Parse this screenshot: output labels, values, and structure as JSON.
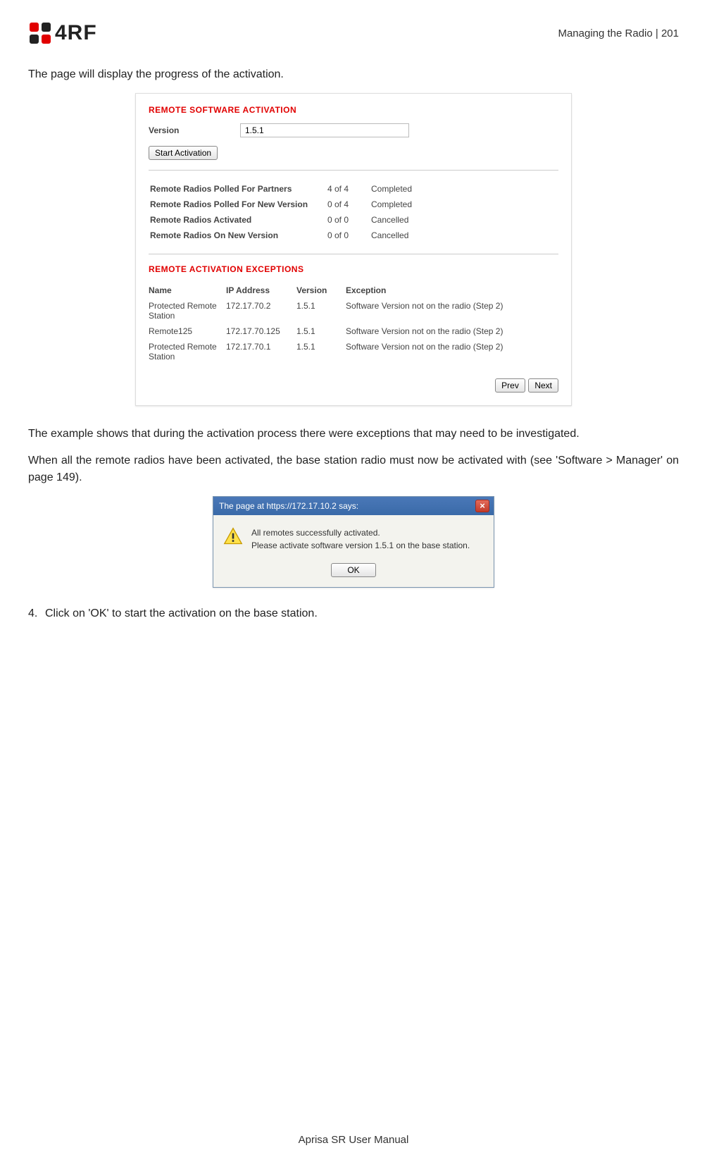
{
  "header": {
    "brand": "4RF",
    "page_ref": "Managing the Radio  |  201"
  },
  "intro": "The page will display the progress of the activation.",
  "fig1": {
    "section1_title": "REMOTE SOFTWARE ACTIVATION",
    "version_label": "Version",
    "version_value": "1.5.1",
    "start_btn": "Start Activation",
    "progress": [
      {
        "label": "Remote Radios Polled For Partners",
        "count": "4 of 4",
        "status": "Completed"
      },
      {
        "label": "Remote Radios Polled For New Version",
        "count": "0 of 4",
        "status": "Completed"
      },
      {
        "label": "Remote Radios Activated",
        "count": "0 of 0",
        "status": "Cancelled"
      },
      {
        "label": "Remote Radios On New Version",
        "count": "0 of 0",
        "status": "Cancelled"
      }
    ],
    "section2_title": "REMOTE ACTIVATION EXCEPTIONS",
    "exc_headers": {
      "name": "Name",
      "ip": "IP Address",
      "version": "Version",
      "exception": "Exception"
    },
    "exceptions": [
      {
        "name": "Protected Remote Station",
        "ip": "172.17.70.2",
        "version": "1.5.1",
        "exception": "Software Version not on the radio (Step 2)"
      },
      {
        "name": "Remote125",
        "ip": "172.17.70.125",
        "version": "1.5.1",
        "exception": "Software Version not on the radio (Step 2)"
      },
      {
        "name": "Protected Remote Station",
        "ip": "172.17.70.1",
        "version": "1.5.1",
        "exception": "Software Version not on the radio (Step 2)"
      }
    ],
    "prev": "Prev",
    "next": "Next"
  },
  "para2": "The example shows that during the activation process there were exceptions that may need to be investigated.",
  "para3": "When all the remote radios have been activated, the base station radio must now be activated with (see 'Software > Manager' on page 149).",
  "fig2": {
    "title": "The page at https://172.17.10.2 says:",
    "line1": "All remotes successfully activated.",
    "line2": "Please activate software version 1.5.1 on the base station.",
    "ok": "OK"
  },
  "step4": {
    "num": "4.",
    "text": "Click on 'OK' to start the activation on the base station."
  },
  "footer": "Aprisa SR User Manual"
}
